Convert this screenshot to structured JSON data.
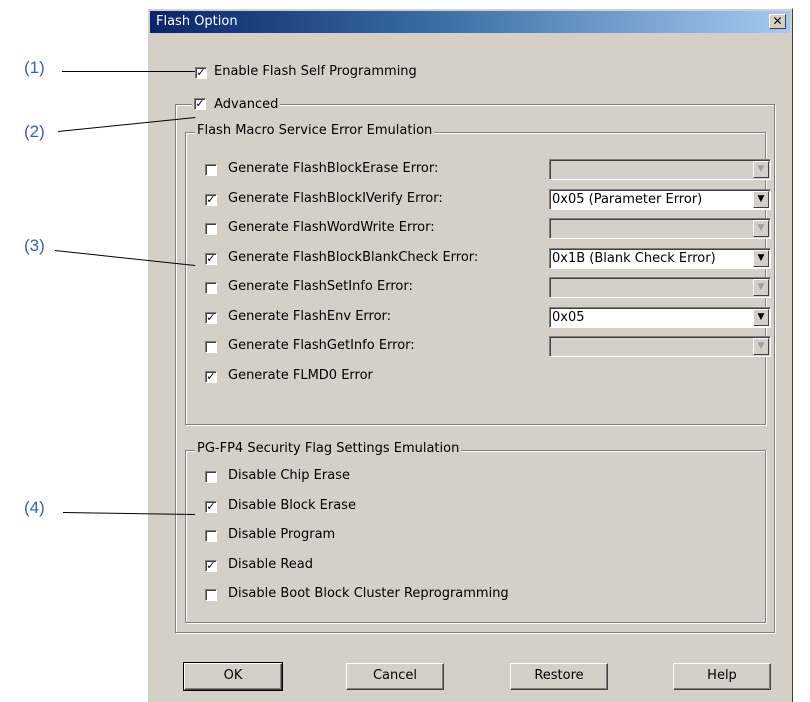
{
  "callouts": [
    "(1)",
    "(2)",
    "(3)",
    "(4)"
  ],
  "window": {
    "title": "Flash Option",
    "close_glyph": "✕"
  },
  "check_glyph": "✓",
  "enable_self_programming": {
    "label": "Enable Flash Self Programming",
    "checked": true
  },
  "advanced": {
    "label": "Advanced",
    "checked": true
  },
  "macro_group": {
    "title": "Flash Macro Service Error Emulation",
    "items": [
      {
        "label": "Generate FlashBlockErase Error:",
        "checked": false,
        "combo": {
          "value": "",
          "enabled": false
        }
      },
      {
        "label": "Generate FlashBlockIVerify Error:",
        "checked": true,
        "combo": {
          "value": "0x05 (Parameter Error)",
          "enabled": true
        }
      },
      {
        "label": "Generate FlashWordWrite Error:",
        "checked": false,
        "combo": {
          "value": "",
          "enabled": false
        }
      },
      {
        "label": "Generate FlashBlockBlankCheck Error:",
        "checked": true,
        "combo": {
          "value": "0x1B (Blank Check Error)",
          "enabled": true
        }
      },
      {
        "label": "Generate FlashSetInfo Error:",
        "checked": false,
        "combo": {
          "value": "",
          "enabled": false
        }
      },
      {
        "label": "Generate FlashEnv Error:",
        "checked": true,
        "combo": {
          "value": "0x05",
          "enabled": true
        }
      },
      {
        "label": "Generate FlashGetInfo Error:",
        "checked": false,
        "combo": {
          "value": "",
          "enabled": false
        }
      },
      {
        "label": "Generate FLMD0 Error",
        "checked": true
      }
    ]
  },
  "security_group": {
    "title": "PG-FP4 Security Flag Settings Emulation",
    "items": [
      {
        "label": "Disable Chip Erase",
        "checked": false
      },
      {
        "label": "Disable Block Erase",
        "checked": true
      },
      {
        "label": "Disable Program",
        "checked": false
      },
      {
        "label": "Disable Read",
        "checked": true
      },
      {
        "label": "Disable Boot Block Cluster Reprogramming",
        "checked": false
      }
    ]
  },
  "buttons": {
    "ok": "OK",
    "cancel": "Cancel",
    "restore": "Restore",
    "help": "Help"
  },
  "colors": {
    "face": "#d4d0c8",
    "callout": "#3a5fb8",
    "title_start": "#0a246a"
  }
}
